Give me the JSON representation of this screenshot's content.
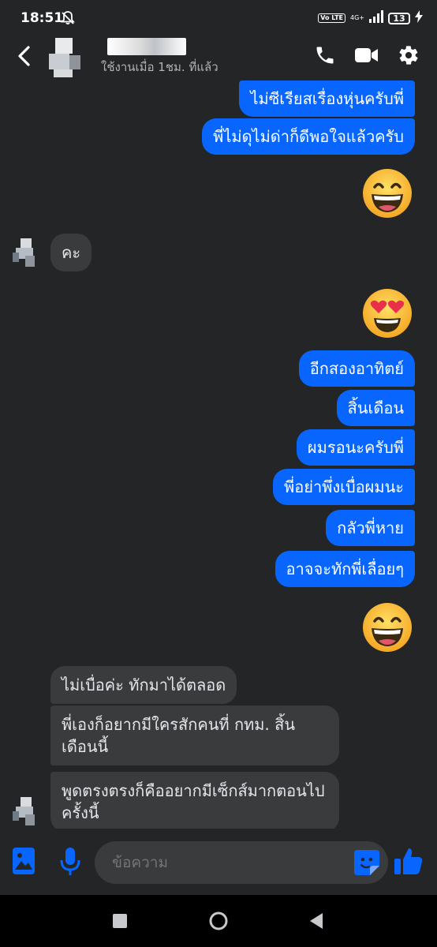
{
  "status_bar": {
    "time": "18:51",
    "volte": "Vo LTE",
    "network": "4G+",
    "battery": "13"
  },
  "header": {
    "contact_status": "ใช้งานเมื่อ 1ชม. ที่แล้ว"
  },
  "messages": {
    "out_1": "ไม่ซีเรียสเรื่องหุ่นครับพี่",
    "out_2": "พี่ไม่ดุไม่ด่าก็ดีพอใจแล้วครับ",
    "in_1": "คะ",
    "out_3": "อีกสองอาทิตย์",
    "out_4": "สิ้นเดือน",
    "out_5": "ผมรอนะครับพี่",
    "out_6": "พี่อย่าพึ่งเบื่อผมนะ",
    "out_7": "กลัวพี่หาย",
    "out_8": "อาจจะทักพี่เลื่อยๆ",
    "in_2": "ไม่เบื่อค่ะ  ทักมาได้ตลอด",
    "in_3": "พี่เองก็อยากมีใครสักคนที่ กทม. สิ้นเดือนนี้",
    "in_4": "พูดตรงตรงก็คืออยากมีเซ็กส์มากตอนไปครั้งนี้"
  },
  "composer": {
    "placeholder": "ข้อความ"
  },
  "colors": {
    "background": "#242526",
    "outgoing_bubble": "#0866ff",
    "incoming_bubble": "#3a3b3c",
    "accent": "#0866ff"
  },
  "icons": [
    "back-arrow-icon",
    "phone-icon",
    "video-camera-icon",
    "gear-icon",
    "grinning-emoji-icon",
    "heart-eyes-emoji-icon",
    "image-icon",
    "microphone-icon",
    "sticker-icon",
    "thumbs-up-icon"
  ]
}
